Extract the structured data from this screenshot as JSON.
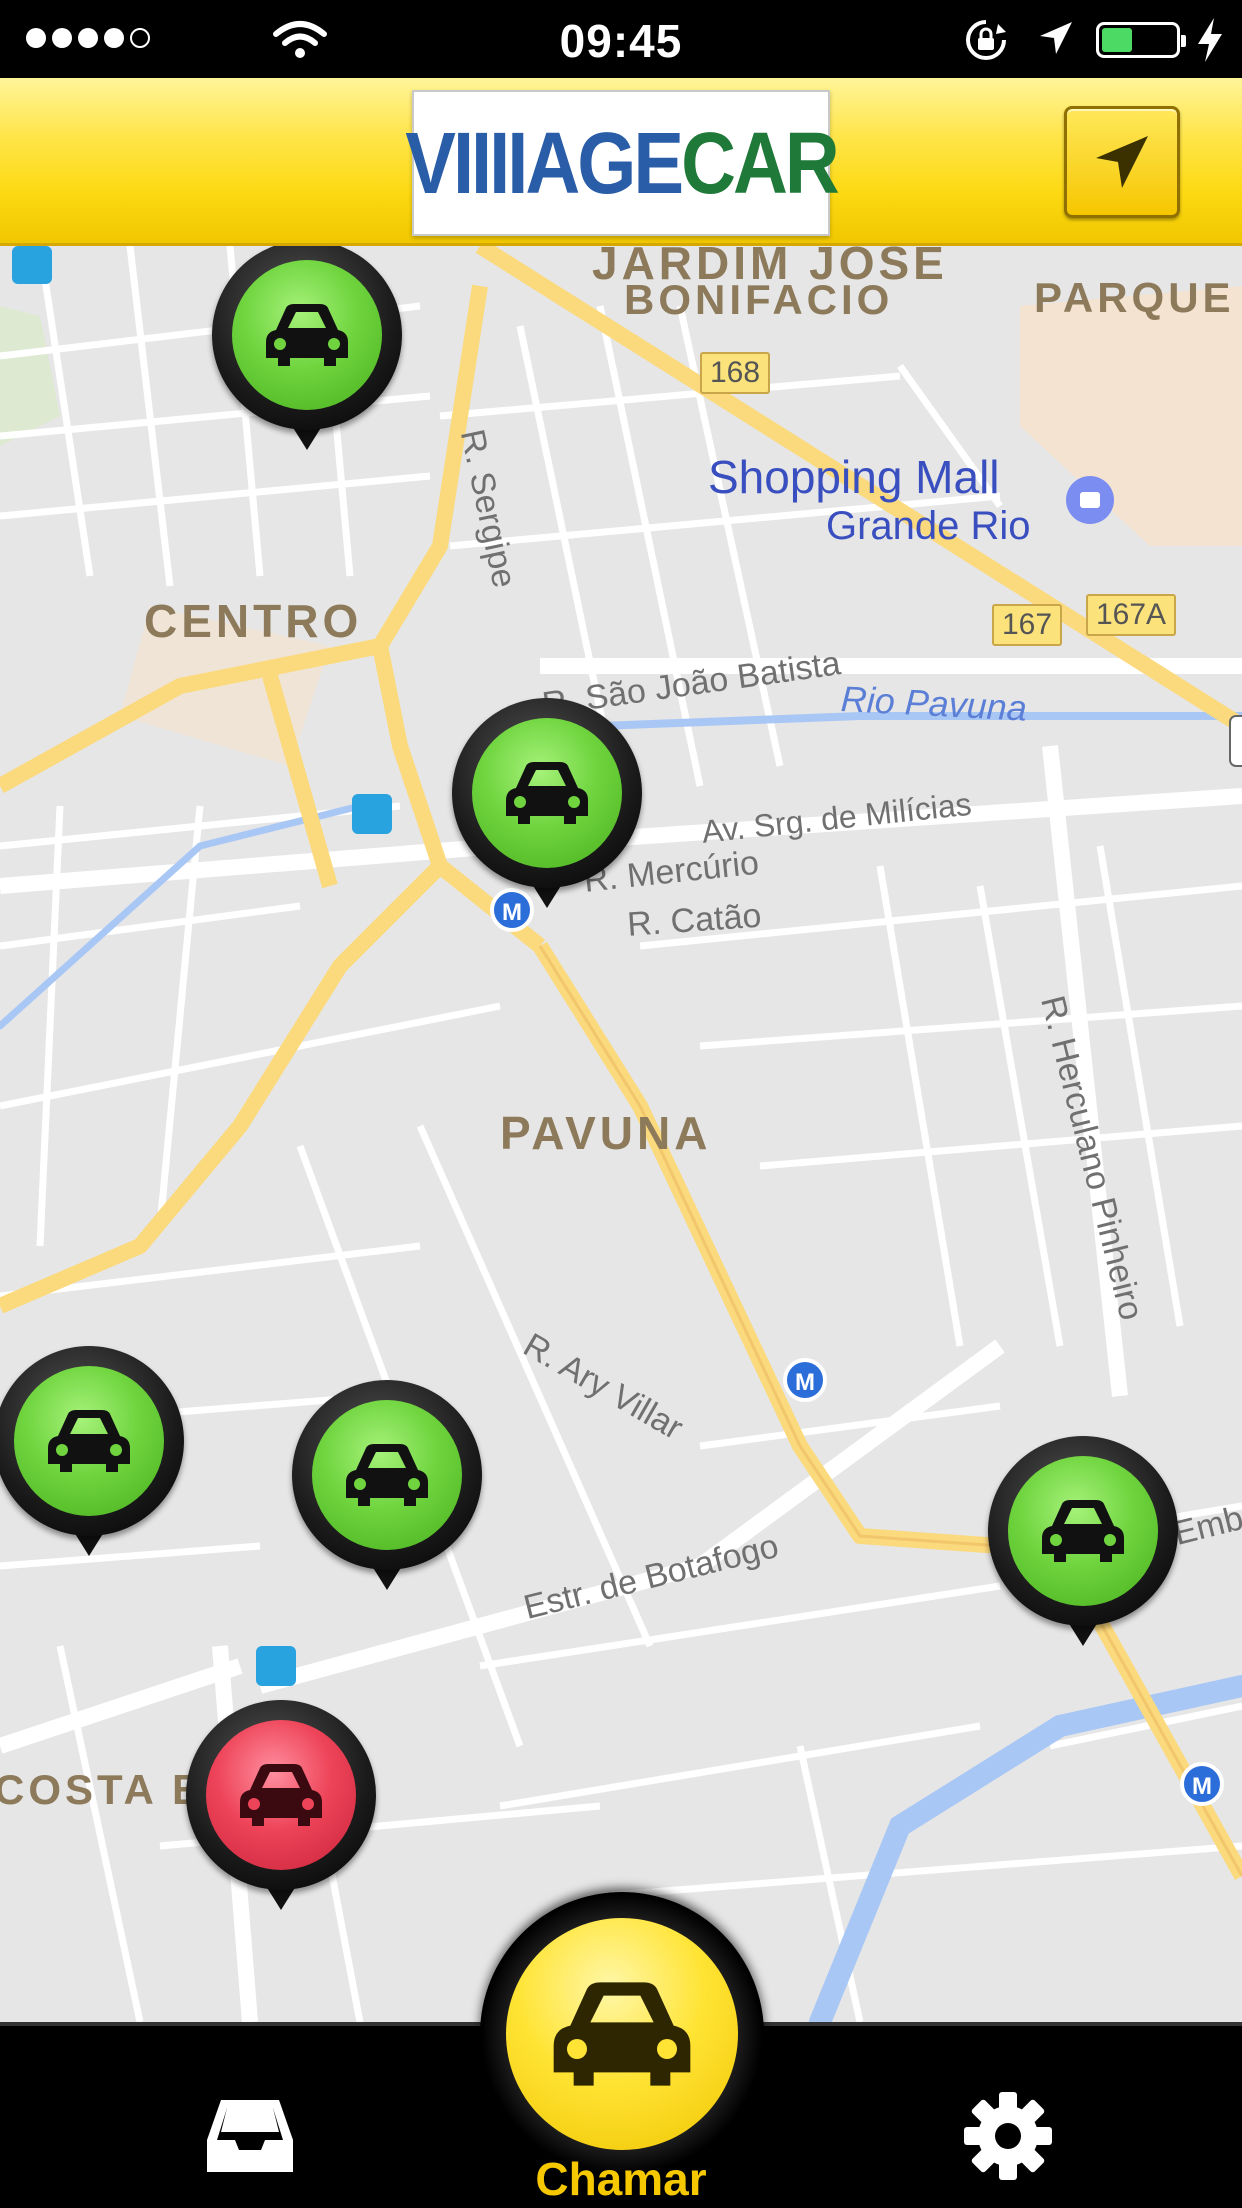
{
  "status_bar": {
    "time": "09:45",
    "signal_bars": 4,
    "battery_level": 0.35,
    "icons": [
      "wifi-icon",
      "rotation-lock-icon",
      "location-arrow-icon",
      "battery-icon",
      "charging-bolt-icon"
    ]
  },
  "header": {
    "logo_text_a": "VIIIIAGE",
    "logo_text_b": "CAR",
    "locate_button_icon": "location-arrow-icon"
  },
  "map": {
    "districts": {
      "jardim": "JARDIM JOSE",
      "bonifacio": "BONIFACIO",
      "parque": "PARQUE",
      "centro": "CENTRO",
      "pavuna": "PAVUNA",
      "costa": "COSTA B"
    },
    "streets": {
      "sergipe": "R. Sergipe",
      "sao_joao": "R. São João Batista",
      "milicias": "Av. Srg. de Milícias",
      "mercurio": "R. Mercúrio",
      "catao": "R. Catão",
      "herculano": "R. Herculano Pinheiro",
      "ary": "R. Ary Villar",
      "botafogo": "Estr. de Botafogo",
      "emb": "Emb"
    },
    "river": "Rio Pavuna",
    "poi_line1": "Shopping Mall",
    "poi_line2": "Grande Rio",
    "shields": {
      "s168": "168",
      "s167": "167",
      "s167a": "167A"
    },
    "cars": [
      {
        "status": "available",
        "color": "#6fd43e"
      },
      {
        "status": "available",
        "color": "#6fd43e"
      },
      {
        "status": "available",
        "color": "#6fd43e"
      },
      {
        "status": "available",
        "color": "#6fd43e"
      },
      {
        "status": "available",
        "color": "#6fd43e"
      },
      {
        "status": "occupied",
        "color": "#ee4459"
      }
    ]
  },
  "bottom_bar": {
    "call_label": "Chamar",
    "inbox_icon": "inbox-icon",
    "settings_icon": "gear-icon",
    "call_icon": "car-icon"
  },
  "colors": {
    "brand_yellow": "#fcd912",
    "available_green": "#6fd43e",
    "occupied_red": "#ee4459",
    "road_yellow": "#fbdc8a"
  }
}
